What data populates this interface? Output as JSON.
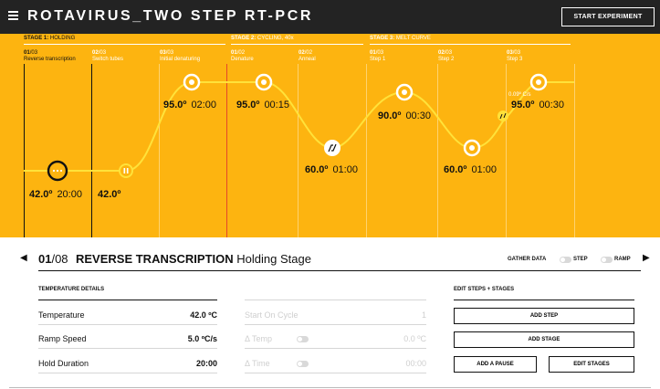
{
  "header": {
    "title": "ROTAVIRUS_TWO STEP RT-PCR",
    "start_button": "START EXPERIMENT"
  },
  "stages": [
    {
      "num": "STAGE 1:",
      "name": "HOLDING"
    },
    {
      "num": "STAGE 2:",
      "name": "CYCLING, 40x"
    },
    {
      "num": "STAGE 3:",
      "name": "MELT CURVE"
    }
  ],
  "steps": [
    {
      "num": "01",
      "of": "/03",
      "name": "Reverse transcription",
      "temp": "42.0º",
      "time": "20:00"
    },
    {
      "num": "02",
      "of": "/03",
      "name": "Switch tubes",
      "temp": "42.0º",
      "time": ""
    },
    {
      "num": "03",
      "of": "/03",
      "name": "Initial denaturing",
      "temp": "95.0º",
      "time": "02:00"
    },
    {
      "num": "01",
      "of": "/02",
      "name": "Denature",
      "temp": "95.0º",
      "time": "00:15"
    },
    {
      "num": "02",
      "of": "/02",
      "name": "Anneal",
      "temp": "60.0º",
      "time": "01:00"
    },
    {
      "num": "01",
      "of": "/03",
      "name": "Step 1",
      "temp": "90.0º",
      "time": "00:30"
    },
    {
      "num": "02",
      "of": "/03",
      "name": "Step 2",
      "temp": "60.0º",
      "time": "01:00"
    },
    {
      "num": "03",
      "of": "/03",
      "name": "Step 3",
      "temp": "95.0º",
      "time": "00:30"
    }
  ],
  "ramp_rate_label": "0.09º C/s",
  "detail": {
    "step_num": "01",
    "step_of": "/08",
    "step_name": "REVERSE TRANSCRIPTION",
    "stage_label": "Holding Stage",
    "gather_label": "GATHER DATA",
    "toggle_step": "STEP",
    "toggle_ramp": "RAMP",
    "temp_details_heading": "TEMPERATURE DETAILS",
    "temperature_label": "Temperature",
    "temperature_value": "42.0 ºC",
    "ramp_label": "Ramp Speed",
    "ramp_value": "5.0 ºC/s",
    "hold_label": "Hold Duration",
    "hold_value": "20:00",
    "start_cycle_label": "Start On Cycle",
    "start_cycle_value": "1",
    "delta_temp_label": "Δ Temp",
    "delta_temp_value": "0.0 ºC",
    "delta_time_label": "Δ Time",
    "delta_time_value": "00:00",
    "edit_heading": "EDIT STEPS + STAGES",
    "add_step": "ADD STEP",
    "add_stage": "ADD STAGE",
    "add_pause": "ADD A PAUSE",
    "edit_stages": "EDIT STAGES"
  },
  "colors": {
    "chart_bg": "#FDB410",
    "curve": "#FFE23A",
    "header_bg": "#232323",
    "active_line": "#111111",
    "divider_red": "#E5482A"
  },
  "icons": {
    "menu": "hamburger-icon",
    "prev": "triangle-left-icon",
    "next": "triangle-right-icon",
    "pause": "pause-icon",
    "more": "ellipsis-icon",
    "ramp": "ramp-slash-icon"
  }
}
